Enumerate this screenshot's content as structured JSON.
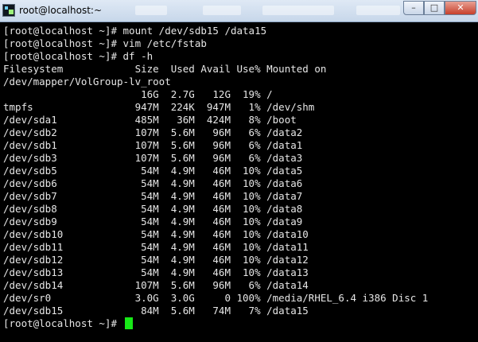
{
  "window": {
    "title": "root@localhost:~"
  },
  "terminal": {
    "lines": [
      "[root@localhost ~]# mount /dev/sdb15 /data15",
      "[root@localhost ~]# vim /etc/fstab",
      "[root@localhost ~]# df -h",
      "Filesystem            Size  Used Avail Use% Mounted on",
      "/dev/mapper/VolGroup-lv_root",
      "                       16G  2.7G   12G  19% /",
      "tmpfs                 947M  224K  947M   1% /dev/shm",
      "/dev/sda1             485M   36M  424M   8% /boot",
      "/dev/sdb2             107M  5.6M   96M   6% /data2",
      "/dev/sdb1             107M  5.6M   96M   6% /data1",
      "/dev/sdb3             107M  5.6M   96M   6% /data3",
      "/dev/sdb5              54M  4.9M   46M  10% /data5",
      "/dev/sdb6              54M  4.9M   46M  10% /data6",
      "/dev/sdb7              54M  4.9M   46M  10% /data7",
      "/dev/sdb8              54M  4.9M   46M  10% /data8",
      "/dev/sdb9              54M  4.9M   46M  10% /data9",
      "/dev/sdb10             54M  4.9M   46M  10% /data10",
      "/dev/sdb11             54M  4.9M   46M  10% /data11",
      "/dev/sdb12             54M  4.9M   46M  10% /data12",
      "/dev/sdb13             54M  4.9M   46M  10% /data13",
      "/dev/sdb14            107M  5.6M   96M   6% /data14",
      "/dev/sr0              3.0G  3.0G     0 100% /media/RHEL_6.4 i386 Disc 1",
      "/dev/sdb15             84M  5.6M   74M   7% /data15"
    ],
    "prompt": "[root@localhost ~]# ",
    "cursor_color": "#17e817"
  }
}
